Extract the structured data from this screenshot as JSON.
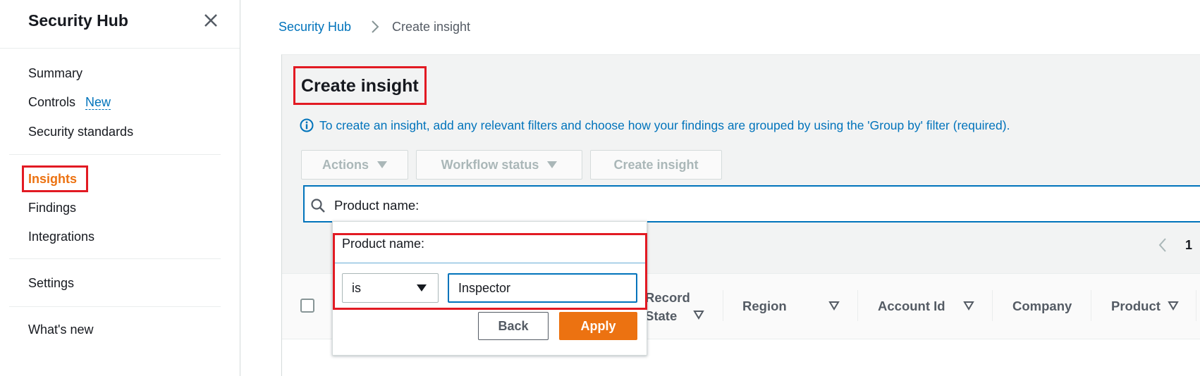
{
  "sidebar": {
    "title": "Security Hub",
    "items": [
      {
        "label": "Summary"
      },
      {
        "label": "Controls",
        "badge": "New"
      },
      {
        "label": "Security standards"
      },
      {
        "label": "Insights",
        "active": true
      },
      {
        "label": "Findings"
      },
      {
        "label": "Integrations"
      },
      {
        "label": "Settings"
      },
      {
        "label": "What's new"
      }
    ]
  },
  "breadcrumb": {
    "root": "Security Hub",
    "current": "Create insight"
  },
  "page": {
    "title": "Create insight",
    "info_text": "To create an insight, add any relevant filters and choose how your findings are grouped by using the 'Group by' filter (required)."
  },
  "toolbar": {
    "actions_label": "Actions",
    "workflow_label": "Workflow status",
    "create_label": "Create insight"
  },
  "search": {
    "value": "Product name:"
  },
  "filter_popover": {
    "label": "Product name:",
    "operator": "is",
    "value": "Inspector",
    "back_label": "Back",
    "apply_label": "Apply"
  },
  "pagination": {
    "current_page": "1"
  },
  "table": {
    "columns": [
      "Record\nState",
      "Region",
      "Account Id",
      "Company",
      "Product"
    ]
  },
  "colors": {
    "accent": "#ec7211",
    "link": "#0073bb",
    "highlight": "#e21a23"
  },
  "icons": [
    "close-icon",
    "chevron-right-icon",
    "info-icon",
    "caret-down-icon",
    "search-icon",
    "chevron-left-icon",
    "sort-down-icon"
  ]
}
